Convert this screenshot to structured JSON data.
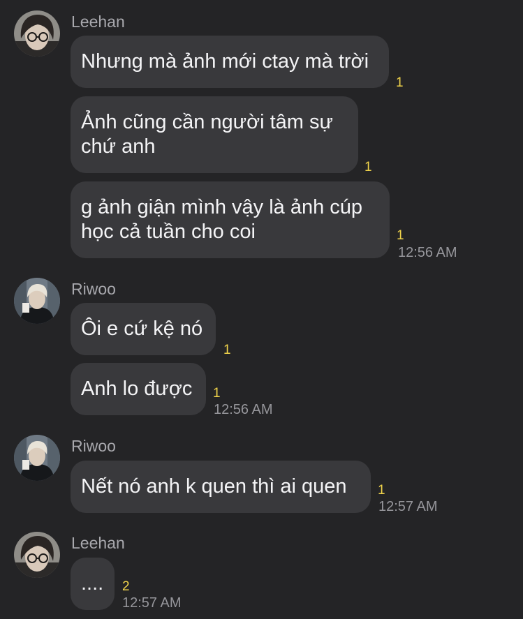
{
  "groups": [
    {
      "sender": "Leehan",
      "messages": [
        {
          "text": "Nhưng mà ảnh mới ctay mà trời",
          "count": "1"
        },
        {
          "text": "Ảnh cũng cần người tâm sự chứ anh",
          "count": "1"
        },
        {
          "text": "g ảnh giận mình vậy là ảnh cúp học cả tuần cho coi",
          "count": "1"
        }
      ],
      "time": "12:56 AM"
    },
    {
      "sender": "Riwoo",
      "messages": [
        {
          "text": "Ôi e cứ kệ nó",
          "count": "1"
        },
        {
          "text": "Anh lo được",
          "count": "1"
        }
      ],
      "time": "12:56 AM"
    },
    {
      "sender": "Riwoo",
      "messages": [
        {
          "text": "Nết nó anh k quen thì ai quen",
          "count": "1"
        }
      ],
      "time": "12:57 AM"
    },
    {
      "sender": "Leehan",
      "messages": [
        {
          "text": "....",
          "count": "2"
        }
      ],
      "time": "12:57 AM"
    }
  ],
  "colors": {
    "background": "#242426",
    "bubble": "#39393c",
    "unread_count": "#f1d44b",
    "sender_name": "#a8a8ad",
    "timestamp": "#96969b"
  }
}
